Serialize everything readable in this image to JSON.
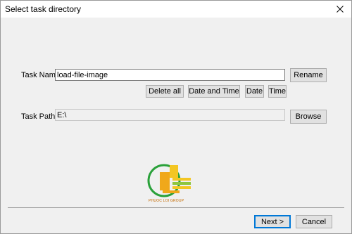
{
  "window": {
    "title": "Select task directory"
  },
  "task_name": {
    "label": "Task Name",
    "value": "load-file-image",
    "rename_label": "Rename"
  },
  "quick_buttons": {
    "delete_all": "Delete all",
    "date_and_time": "Date and Time",
    "date": "Date",
    "time": "Time"
  },
  "task_path": {
    "label": "Task Path",
    "value": "E:\\",
    "browse_label": "Browse"
  },
  "logo": {
    "text": "PHUOC LOI GROUP"
  },
  "footer": {
    "next_label": "Next >",
    "cancel_label": "Cancel"
  }
}
